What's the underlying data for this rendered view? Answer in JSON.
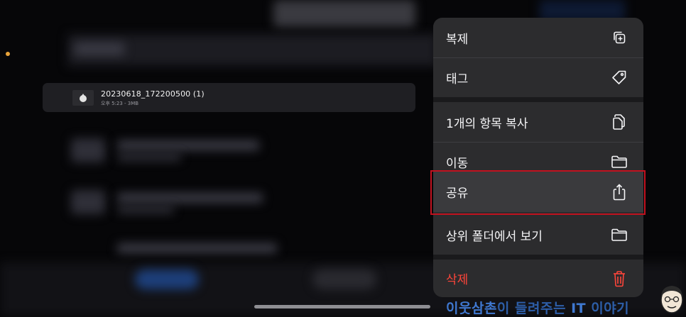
{
  "file": {
    "name": "20230618_172200500 (1)",
    "meta": "오후 5:23 - 3MB"
  },
  "menu": {
    "items": [
      {
        "label": "복제",
        "icon": "duplicate-icon"
      },
      {
        "label": "태그",
        "icon": "tag-icon"
      },
      {
        "label": "1개의 항목 복사",
        "icon": "copy-icon"
      },
      {
        "label": "이동",
        "icon": "folder-icon"
      },
      {
        "label": "공유",
        "icon": "share-icon"
      },
      {
        "label": "상위 폴더에서 보기",
        "icon": "folder-icon"
      },
      {
        "label": "삭제",
        "icon": "trash-icon"
      }
    ],
    "highlighted": "공유"
  },
  "watermark": {
    "part1": "이웃삼촌",
    "part2": "이 들려주는 ",
    "part3": "IT",
    "part4": " 이야기"
  },
  "colors": {
    "accent_red": "#ff453a",
    "highlight_outline": "#c1121f",
    "menu_bg": "#2c2c2e"
  }
}
